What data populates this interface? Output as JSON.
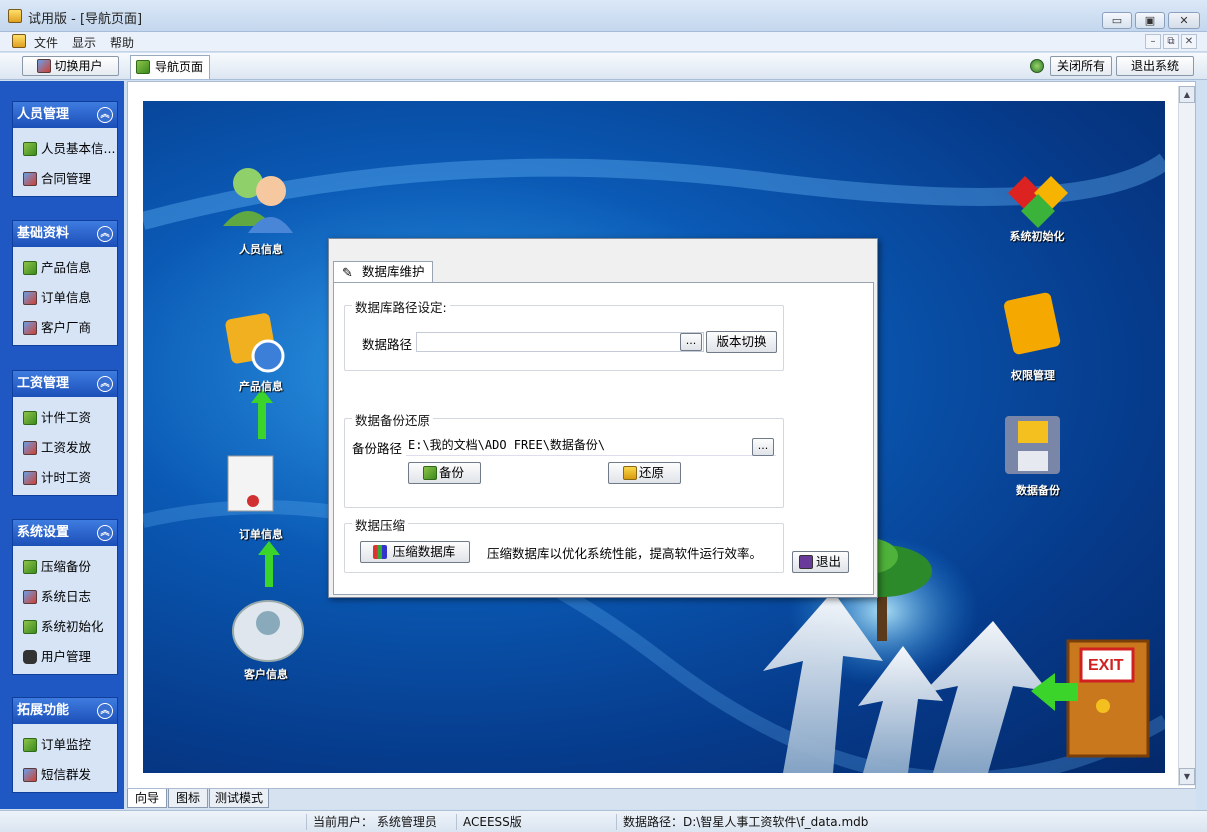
{
  "window": {
    "title": "试用版 - [导航页面]",
    "min": "▭",
    "max": "▣",
    "close": "✕"
  },
  "menu": {
    "items": [
      "文件",
      "显示",
      "帮助"
    ],
    "mdi_min": "–",
    "mdi_restore": "⧉",
    "mdi_close": "✕"
  },
  "toolbar": {
    "switch_user": "切换用户",
    "tab": "导航页面",
    "close_all": "关闭所有",
    "exit_system": "退出系统"
  },
  "sidebar": {
    "groups": [
      {
        "title": "人员管理",
        "items": [
          "人员基本信...",
          "合同管理"
        ]
      },
      {
        "title": "基础资料",
        "items": [
          "产品信息",
          "订单信息",
          "客户厂商"
        ]
      },
      {
        "title": "工资管理",
        "items": [
          "计件工资",
          "工资发放",
          "计时工资"
        ]
      },
      {
        "title": "系统设置",
        "items": [
          "压缩备份",
          "系统日志",
          "系统初始化",
          "用户管理"
        ]
      },
      {
        "title": "拓展功能",
        "items": [
          "订单监控",
          "短信群发"
        ]
      }
    ],
    "collapse_glyph": "︽"
  },
  "hero": {
    "labels": {
      "person": "人员信息",
      "product": "产品信息",
      "order": "订单信息",
      "customer": "客户信息",
      "init": "系统初始化",
      "perm": "权限管理",
      "backup": "数据备份",
      "exit": "EXIT"
    }
  },
  "dialog": {
    "tab": "数据库维护",
    "path_group": "数据库路径设定:",
    "path_label": "数据路径",
    "path_value": "",
    "browse": "...",
    "version_switch": "版本切换",
    "backup_group": "数据备份还原",
    "backup_label": "备份路径",
    "backup_value": "E:\\我的文档\\ADO FREE\\数据备份\\",
    "backup_btn": "备份",
    "restore_btn": "还原",
    "compress_group": "数据压缩",
    "compress_btn": "压缩数据库",
    "compress_desc": "压缩数据库以优化系统性能，提高软件运行效率。",
    "exit_btn": "退出"
  },
  "bottom_tabs": [
    "向导",
    "图标",
    "测试模式"
  ],
  "status": {
    "user_label": "当前用户：",
    "user": "系统管理员",
    "edition": "ACEESS版",
    "path": "数据路径：D:\\智星人事工资软件\\f_data.mdb"
  },
  "scroll": {
    "up": "▲",
    "down": "▼"
  }
}
